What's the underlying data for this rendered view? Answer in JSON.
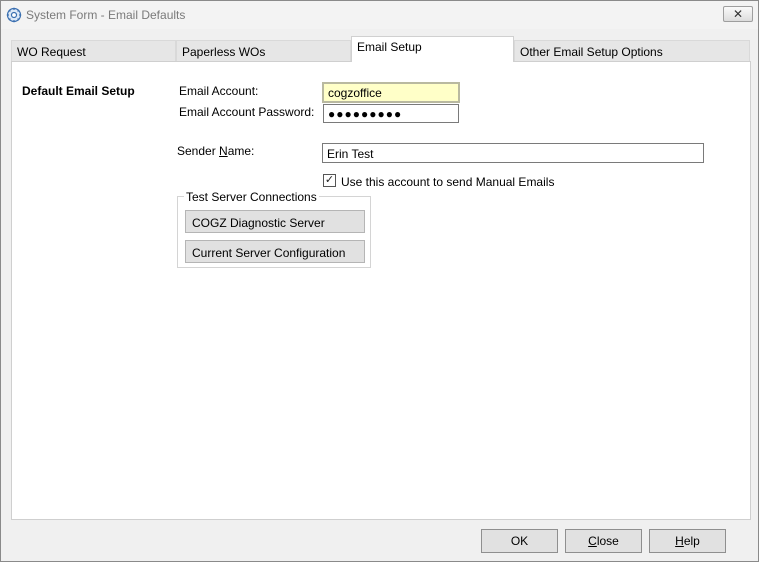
{
  "window": {
    "title": "System Form - Email Defaults",
    "close_glyph": "✕"
  },
  "tabs": [
    {
      "label": "WO Request"
    },
    {
      "label": "Paperless WOs"
    },
    {
      "label": "Email Setup",
      "active": true
    },
    {
      "label": "Other Email Setup Options"
    }
  ],
  "section": {
    "heading": "Default Email Setup"
  },
  "fields": {
    "email_account_label": "Email Account:",
    "email_account_value": "cogzoffice",
    "password_label": "Email Account Password:",
    "password_value": "●●●●●●●●●",
    "sender_label_pre": "Sender ",
    "sender_label_u": "N",
    "sender_label_post": "ame:",
    "sender_value": "Erin Test",
    "manual_checkbox_label": "Use this account to send Manual Emails",
    "manual_checkbox_checked": true,
    "check_glyph": "✓"
  },
  "test_group": {
    "title": "Test Server Connections",
    "diag_button": "COGZ Diagnostic Server",
    "config_button": "Current Server Configuration"
  },
  "footer": {
    "ok": "OK",
    "close_u": "C",
    "close_rest": "lose",
    "help_u": "H",
    "help_rest": "elp"
  }
}
